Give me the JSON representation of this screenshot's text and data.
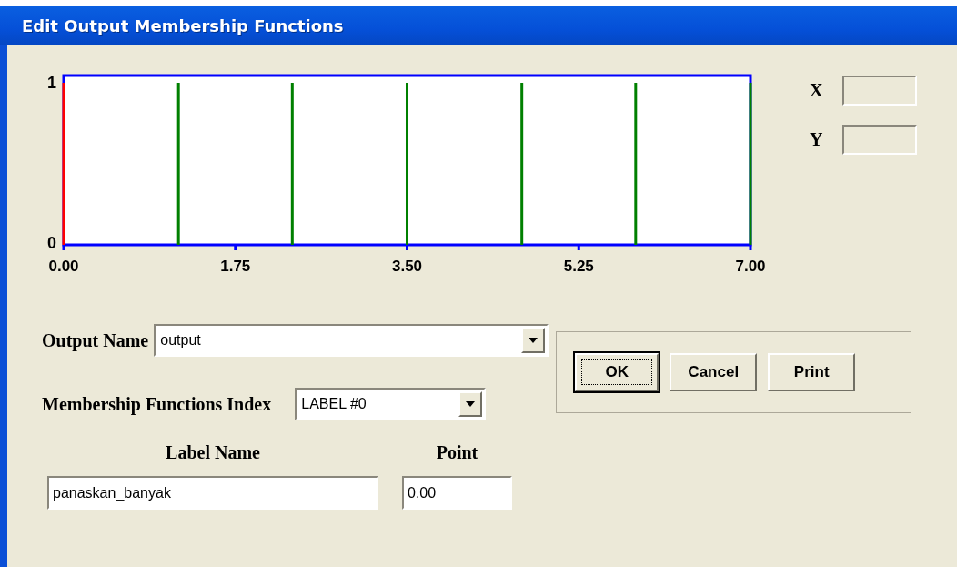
{
  "window": {
    "title": "Edit Output Membership Functions"
  },
  "chart": {
    "chart_data": {
      "type": "bar",
      "x": [
        0,
        1.17,
        2.33,
        3.5,
        4.67,
        5.83,
        7
      ],
      "xlim": [
        0,
        7
      ],
      "ylim": [
        0,
        1
      ],
      "xticks": [
        {
          "value": 0,
          "label": "0.00"
        },
        {
          "value": 1.75,
          "label": "1.75"
        },
        {
          "value": 3.5,
          "label": "3.50"
        },
        {
          "value": 5.25,
          "label": "5.25"
        },
        {
          "value": 7,
          "label": "7.00"
        }
      ],
      "yticks": [
        0,
        1
      ],
      "series": [
        {
          "color": "#ff0000",
          "values": [
            1,
            null,
            null,
            null,
            null,
            null,
            null
          ]
        },
        {
          "color": "#008000",
          "values": [
            null,
            1,
            1,
            1,
            1,
            1,
            1
          ]
        }
      ]
    }
  },
  "readout": [
    {
      "label": "X"
    },
    {
      "label": "Y"
    }
  ],
  "output_name": {
    "label": "Output Name",
    "value": "output"
  },
  "mf_index": {
    "label": "Membership Functions Index",
    "value": "LABEL #0"
  },
  "label_name": {
    "label": "Label Name",
    "value": "panaskan_banyak"
  },
  "point": {
    "label": "Point",
    "value": "0.00"
  },
  "buttons": [
    {
      "label": "OK",
      "focused": true
    },
    {
      "label": "Cancel",
      "focused": false
    },
    {
      "label": "Print",
      "focused": false
    }
  ]
}
